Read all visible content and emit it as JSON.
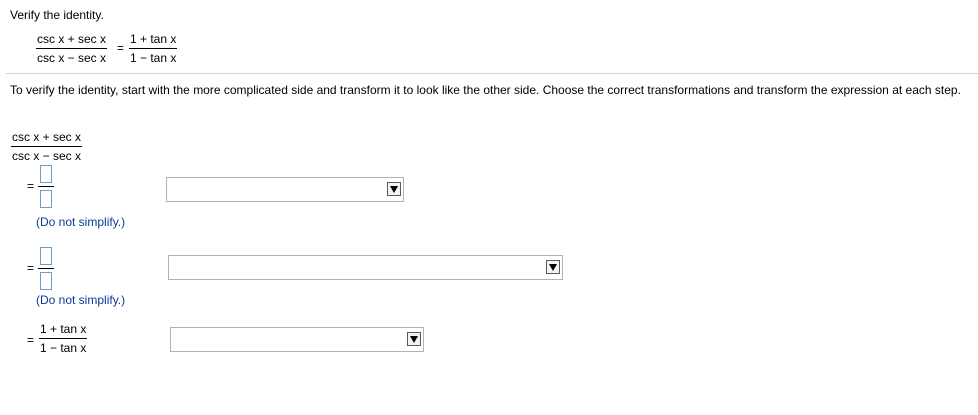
{
  "instruction_title": "Verify the identity.",
  "identity": {
    "lhs": {
      "numerator": "csc x + sec x",
      "denominator": "csc x − sec x"
    },
    "equals": "=",
    "rhs": {
      "numerator": "1 + tan x",
      "denominator": "1 − tan x"
    }
  },
  "instructions": "To verify the identity, start with the more complicated side and transform it to look like the other side. Choose the correct transformations and transform the expression at each step.",
  "work": {
    "start": {
      "numerator": "csc x + sec x",
      "denominator": "csc x − sec x"
    },
    "step1": {
      "equals": "=",
      "hint": "(Do not simplify.)",
      "dropdown_value": ""
    },
    "step2": {
      "equals": "=",
      "hint": "(Do not simplify.)",
      "dropdown_value": ""
    },
    "step3": {
      "equals": "=",
      "numerator": "1 + tan x",
      "denominator": "1 − tan x",
      "dropdown_value": ""
    }
  }
}
